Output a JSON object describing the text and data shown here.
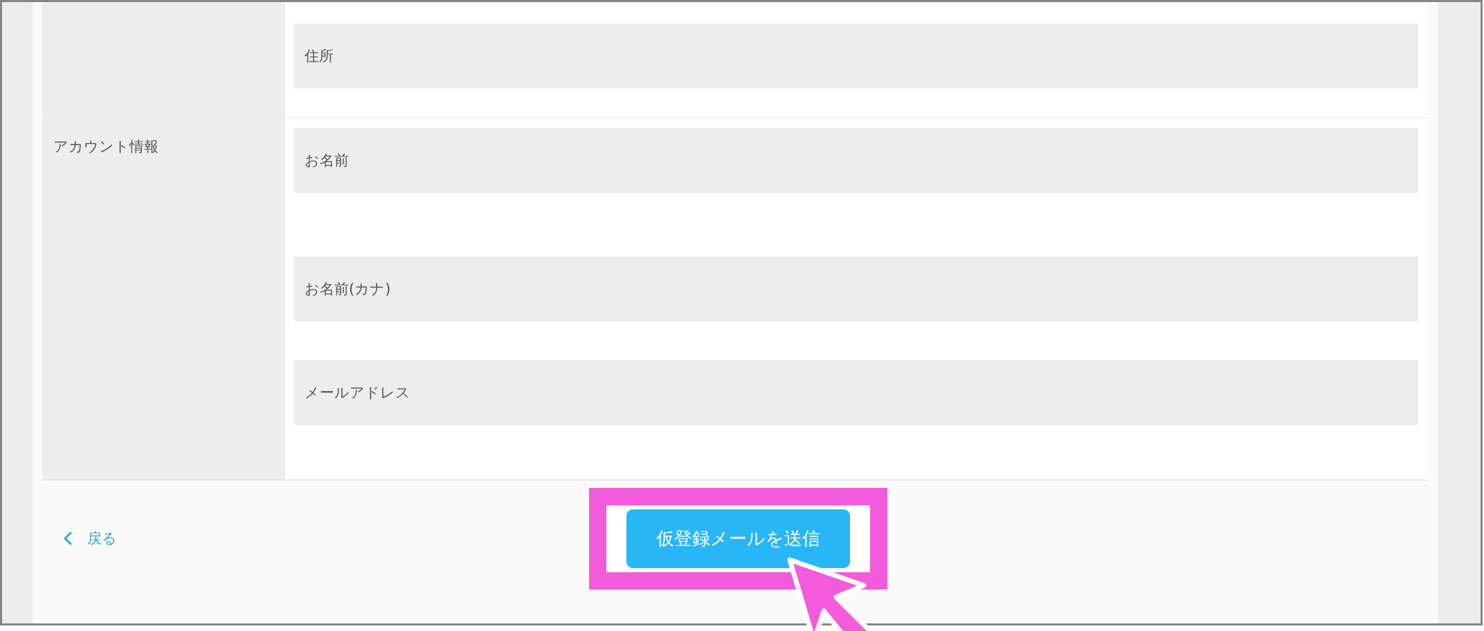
{
  "form": {
    "rows": [
      {
        "fields": [
          {
            "placeholder": "住所"
          }
        ]
      },
      {
        "label": "アカウント情報",
        "fields": [
          {
            "placeholder": "お名前"
          },
          {
            "placeholder": "お名前(カナ)"
          },
          {
            "placeholder": "メールアドレス"
          }
        ]
      }
    ]
  },
  "footer": {
    "back_link": {
      "label": "戻る"
    },
    "submit_button": {
      "label": "仮登録メールを送信",
      "highlighted": true
    }
  }
}
